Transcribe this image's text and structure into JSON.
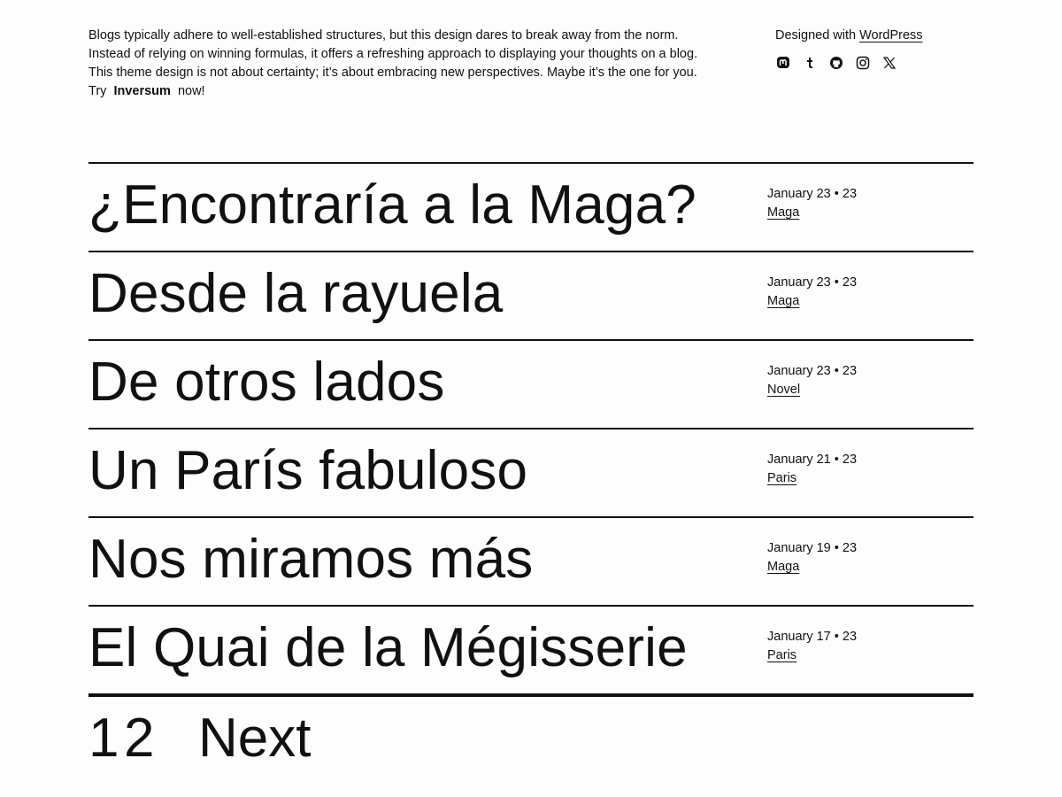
{
  "intro": {
    "paragraph": "Blogs typically adhere to well-established structures, but this design dares to break away from the norm. Instead of relying on winning formulas, it offers a refreshing approach to displaying your thoughts on a blog. This theme design is not about certainty; it’s about embracing new perspectives. Maybe it’s the one for you.",
    "try_prefix": "Try",
    "try_name": "Inversum",
    "try_suffix": "now!"
  },
  "credit": {
    "prefix": "Designed with ",
    "link": "WordPress",
    "socials": [
      {
        "icon": "mastodon-icon"
      },
      {
        "icon": "tumblr-icon"
      },
      {
        "icon": "github-icon"
      },
      {
        "icon": "instagram-icon"
      },
      {
        "icon": "x-icon"
      }
    ]
  },
  "posts": [
    {
      "title": "¿Encontraría a la Maga?",
      "date": "January 23 • 23",
      "category": "Maga"
    },
    {
      "title": "Desde la rayuela",
      "date": "January 23 • 23",
      "category": "Maga"
    },
    {
      "title": "De otros lados",
      "date": "January 23 • 23",
      "category": "Novel"
    },
    {
      "title": "Un París fabuloso",
      "date": "January 21 • 23",
      "category": "Paris"
    },
    {
      "title": "Nos miramos más",
      "date": "January 19 • 23",
      "category": "Maga"
    },
    {
      "title": "El Quai de la Mégisserie",
      "date": "January 17 • 23",
      "category": "Paris"
    }
  ],
  "pagination": {
    "pages": [
      "1",
      "2"
    ],
    "next_label": "Next"
  }
}
